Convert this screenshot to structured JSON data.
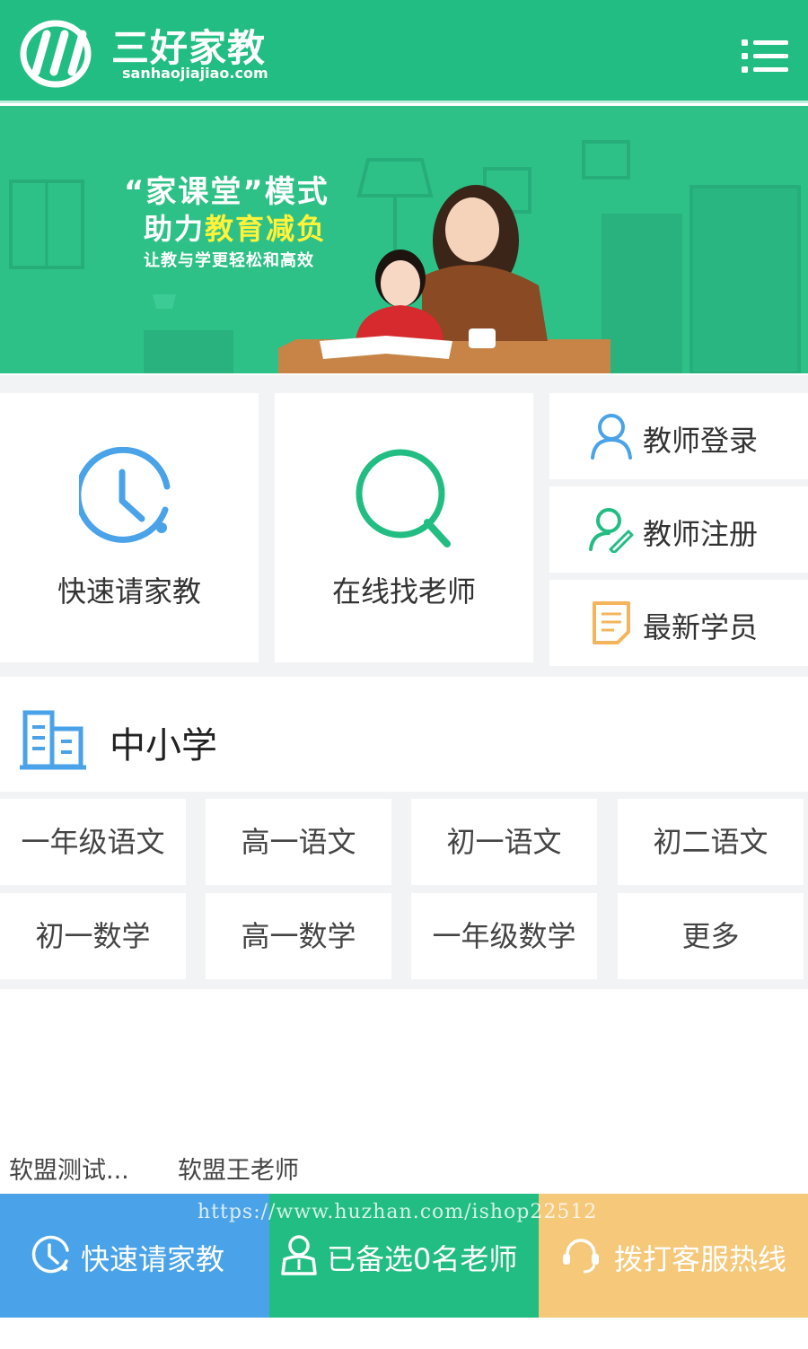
{
  "colors": {
    "brand_green": "#22bd82",
    "accent_blue": "#4aa3e8",
    "accent_orange": "#f6c87a",
    "highlight_yellow": "#fff23a"
  },
  "header": {
    "title": "三好家教",
    "domain": "sanhaojiajiao.com",
    "logo_icon": "logo-swoosh",
    "menu_icon": "list-menu-icon"
  },
  "banner": {
    "line1": "“家课堂”模式",
    "line2_prefix": "助力",
    "line2_highlight": "教育减负",
    "line3": "让教与学更轻松和高效"
  },
  "actions": {
    "quick_request": {
      "label": "快速请家教",
      "icon": "clock-icon"
    },
    "find_teacher": {
      "label": "在线找老师",
      "icon": "search-icon"
    },
    "teacher_login": {
      "label": "教师登录",
      "icon": "user-icon"
    },
    "teacher_register": {
      "label": "教师注册",
      "icon": "user-edit-icon"
    },
    "latest_students": {
      "label": "最新学员",
      "icon": "document-icon"
    }
  },
  "category": {
    "title": "中小学",
    "icon": "building-icon",
    "items": [
      {
        "label": "一年级语文"
      },
      {
        "label": "高一语文"
      },
      {
        "label": "初一语文"
      },
      {
        "label": "初二语文"
      },
      {
        "label": "初一数学"
      },
      {
        "label": "高一数学"
      },
      {
        "label": "一年级数学"
      },
      {
        "label": "更多"
      }
    ]
  },
  "bottom_tags": [
    {
      "label": "软盟测试..."
    },
    {
      "label": "软盟王老师"
    }
  ],
  "bottom_bar": {
    "quick_request": "快速请家教",
    "selected_teachers": "已备选0名老师",
    "hotline": "拨打客服热线"
  },
  "watermark": "https://www.huzhan.com/ishop22512"
}
